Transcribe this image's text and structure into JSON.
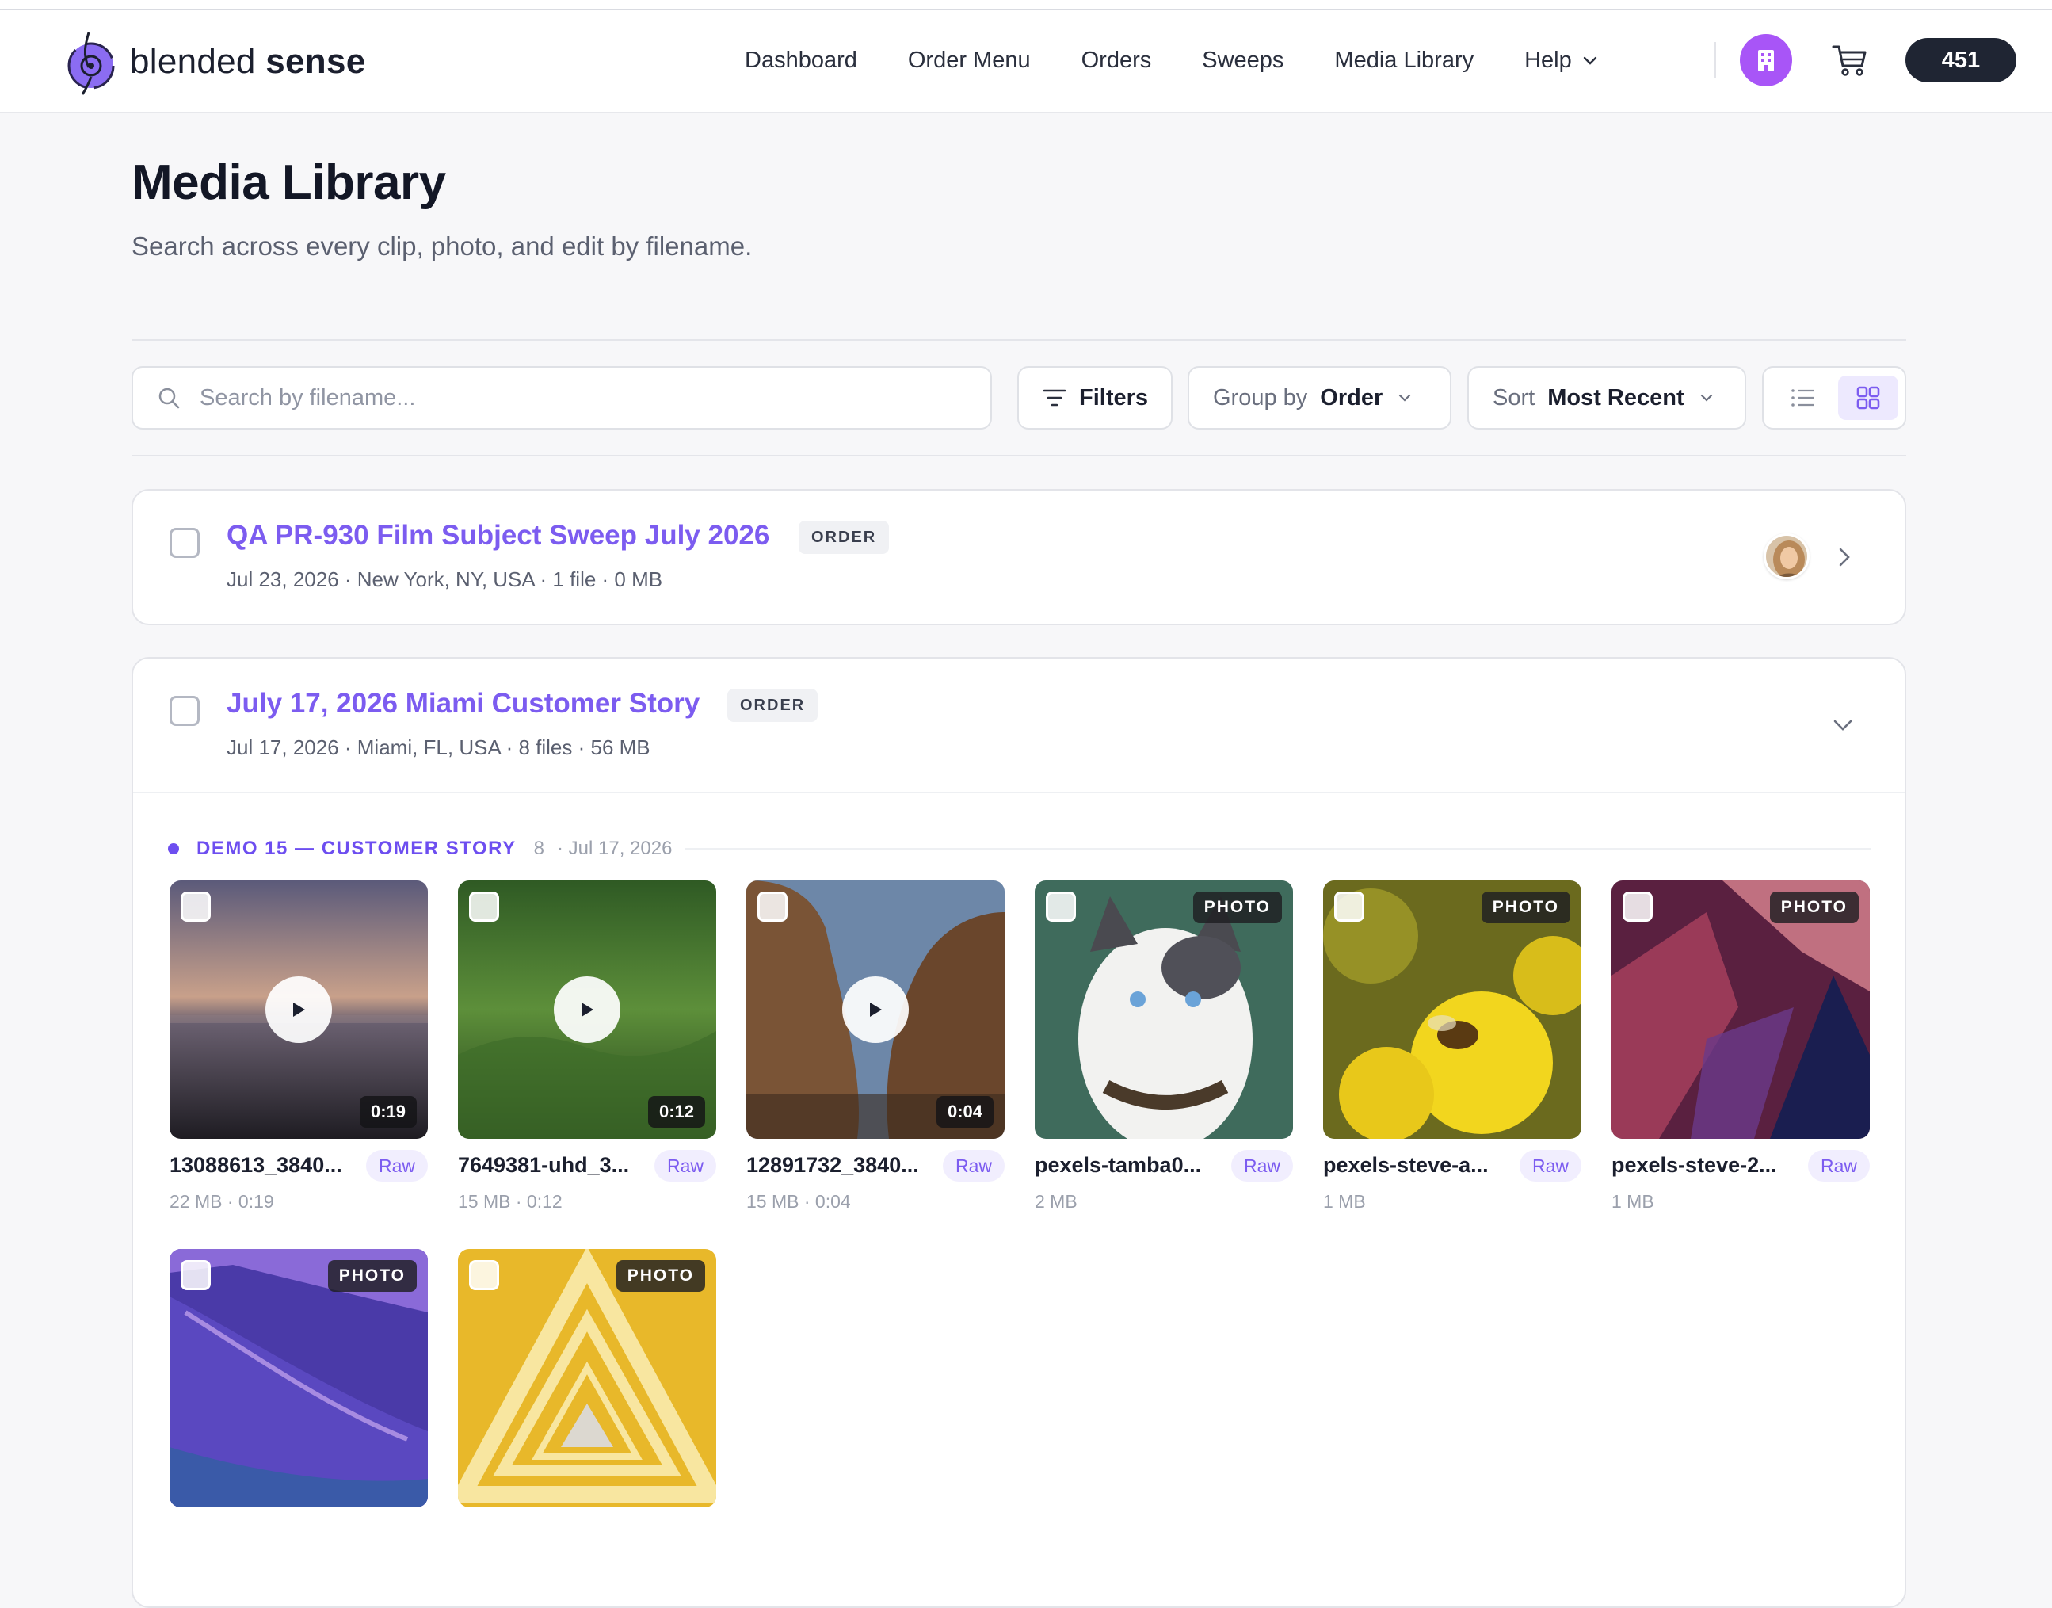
{
  "brand": {
    "name_light": "blended",
    "name_bold": "sense",
    "accent": "#7c5cf0"
  },
  "nav": {
    "links": [
      "Dashboard",
      "Order Menu",
      "Orders",
      "Sweeps",
      "Media Library"
    ],
    "help_label": "Help",
    "credits": "451"
  },
  "page": {
    "title": "Media Library",
    "subtitle": "Search across every clip, photo, and edit by filename."
  },
  "toolbar": {
    "search_placeholder": "Search by filename...",
    "filters_label": "Filters",
    "group_by_label": "Group by",
    "group_by_value": "Order",
    "sort_label": "Sort",
    "sort_value": "Most Recent",
    "view_mode": "grid"
  },
  "orders": [
    {
      "title": "QA PR-930 Film Subject Sweep July 2026",
      "badge": "ORDER",
      "meta": "Jul 23, 2026 · New York, NY, USA · 1 file · 0 MB",
      "expanded": false
    },
    {
      "title": "July 17, 2026 Miami Customer Story",
      "badge": "ORDER",
      "meta": "Jul 17, 2026 · Miami, FL, USA · 8 files · 56 MB",
      "expanded": true,
      "section": {
        "title": "DEMO 15 — CUSTOMER STORY",
        "count": "8",
        "date": "· Jul 17, 2026"
      },
      "files": [
        {
          "name": "13088613_3840...",
          "tag": "Raw",
          "meta": "22 MB · 0:19",
          "kind": "video",
          "duration": "0:19"
        },
        {
          "name": "7649381-uhd_3...",
          "tag": "Raw",
          "meta": "15 MB · 0:12",
          "kind": "video",
          "duration": "0:12"
        },
        {
          "name": "12891732_3840...",
          "tag": "Raw",
          "meta": "15 MB · 0:04",
          "kind": "video",
          "duration": "0:04"
        },
        {
          "name": "pexels-tamba0...",
          "tag": "Raw",
          "meta": "2 MB",
          "kind": "photo",
          "label": "PHOTO"
        },
        {
          "name": "pexels-steve-a...",
          "tag": "Raw",
          "meta": "1 MB",
          "kind": "photo",
          "label": "PHOTO"
        },
        {
          "name": "pexels-steve-2...",
          "tag": "Raw",
          "meta": "1 MB",
          "kind": "photo",
          "label": "PHOTO"
        },
        {
          "name": "",
          "tag": "",
          "meta": "",
          "kind": "photo",
          "label": "PHOTO"
        },
        {
          "name": "",
          "tag": "",
          "meta": "",
          "kind": "photo",
          "label": "PHOTO"
        }
      ]
    }
  ]
}
